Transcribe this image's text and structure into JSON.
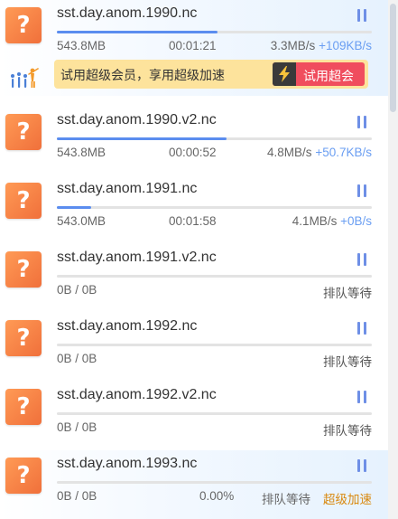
{
  "downloads": [
    {
      "name": "sst.day.anom.1990.nc",
      "size": "543.8MB",
      "time": "00:01:21",
      "speed": "3.3MB/s",
      "boost": "+109KB/s",
      "progress": 0.51
    },
    {
      "name": "sst.day.anom.1990.v2.nc",
      "size": "543.8MB",
      "time": "00:00:52",
      "speed": "4.8MB/s",
      "boost": "+50.7KB/s",
      "progress": 0.54
    },
    {
      "name": "sst.day.anom.1991.nc",
      "size": "543.0MB",
      "time": "00:01:58",
      "speed": "4.1MB/s",
      "boost": "+0B/s",
      "progress": 0.11
    },
    {
      "name": "sst.day.anom.1991.v2.nc",
      "size": "0B / 0B",
      "status": "排队等待",
      "progress": 0
    },
    {
      "name": "sst.day.anom.1992.nc",
      "size": "0B / 0B",
      "status": "排队等待",
      "progress": 0
    },
    {
      "name": "sst.day.anom.1992.v2.nc",
      "size": "0B / 0B",
      "status": "排队等待",
      "progress": 0
    },
    {
      "name": "sst.day.anom.1993.nc",
      "size": "0B / 0B",
      "percent": "0.00%",
      "status": "排队等待",
      "accelerate": "超级加速",
      "progress": 0
    }
  ],
  "vip": {
    "text": "试用超级会员，享用超级加速",
    "button_label": "试用超会"
  },
  "icons": {
    "file": "unknown-file-icon",
    "pause": "pause-icon",
    "bolt": "lightning-bolt-icon"
  },
  "colors": {
    "progress": "#5b8def",
    "speed_boost": "#6a9ef2",
    "accelerate": "#d9890f",
    "vip_banner": "#fde39c",
    "vip_button": "#f04d5e"
  }
}
